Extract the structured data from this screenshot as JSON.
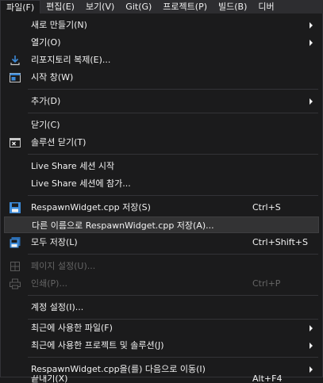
{
  "menubar": {
    "items": [
      {
        "label": "파일(F)"
      },
      {
        "label": "편집(E)"
      },
      {
        "label": "보기(V)"
      },
      {
        "label": "Git(G)"
      },
      {
        "label": "프로젝트(P)"
      },
      {
        "label": "빌드(B)"
      },
      {
        "label": "디버"
      }
    ]
  },
  "file_menu": {
    "new": "새로 만들기(N)",
    "open": "열기(O)",
    "clone": "리포지토리 복제(E)...",
    "start_window": "시작 창(W)",
    "add": "추가(D)",
    "close": "닫기(C)",
    "close_solution": "솔루션 닫기(T)",
    "live_share_start": "Live Share 세션 시작",
    "live_share_join": "Live Share 세션에 참가...",
    "save": "RespawnWidget.cpp 저장(S)",
    "save_shortcut": "Ctrl+S",
    "save_as": "다른 이름으로 RespawnWidget.cpp 저장(A)...",
    "save_all": "모두 저장(L)",
    "save_all_shortcut": "Ctrl+Shift+S",
    "page_setup": "페이지 설정(U)...",
    "print": "인쇄(P)...",
    "print_shortcut": "Ctrl+P",
    "account_settings": "계정 설정(I)...",
    "recent_files": "최근에 사용한 파일(F)",
    "recent_projects": "최근에 사용한 프로젝트 및 솔루션(J)",
    "move_to": "RespawnWidget.cpp을(를) 다음으로 이동(I)",
    "exit": "끝내기(X)",
    "exit_shortcut": "Alt+F4"
  },
  "colors": {
    "menu_bg": "#1b1b1c",
    "menubar_bg": "#2d2d30",
    "highlight_bg": "#333334",
    "text": "#f1f1f1",
    "disabled_text": "#656565",
    "icon_blue": "#3c8ad8"
  },
  "icons": {
    "clone": "download-arrow-icon",
    "start_window": "start-window-icon",
    "close_solution": "close-solution-icon",
    "save": "floppy-disk-icon",
    "save_all": "save-all-icon",
    "page_setup": "page-setup-icon",
    "print": "printer-icon"
  }
}
